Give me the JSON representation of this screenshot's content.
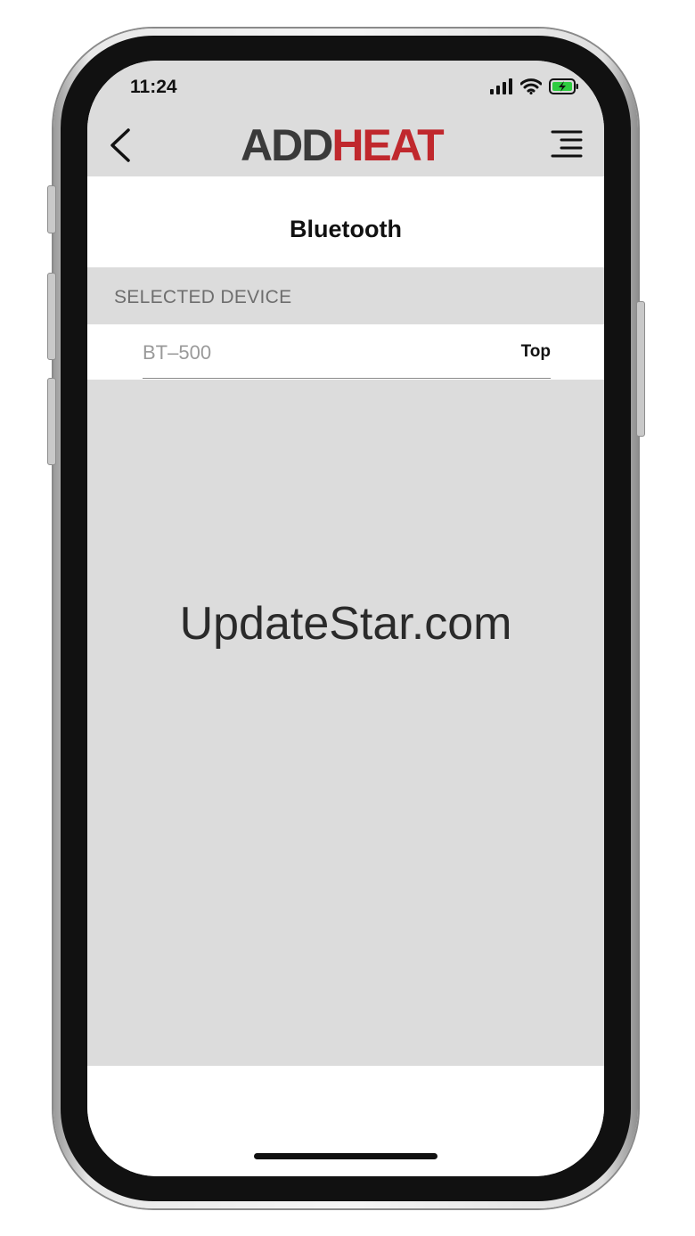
{
  "status_bar": {
    "time": "11:24",
    "icons": [
      "cellular-signal-icon",
      "wifi-icon",
      "battery-charging-icon"
    ],
    "battery_color": "#2ecc40"
  },
  "header": {
    "back_icon": "chevron-left-icon",
    "brand": {
      "part1": "ADD",
      "part2": "HEAT",
      "color_primary": "#3a3a3a",
      "color_accent": "#c0282d"
    },
    "menu_icon": "hamburger-menu-icon"
  },
  "page": {
    "title": "Bluetooth"
  },
  "section": {
    "label": "SELECTED DEVICE"
  },
  "device": {
    "name": "BT–500",
    "tag": "Top"
  },
  "watermark": "UpdateStar.com",
  "colors": {
    "panel_gray": "#dcdcdc",
    "background": "#ffffff"
  }
}
